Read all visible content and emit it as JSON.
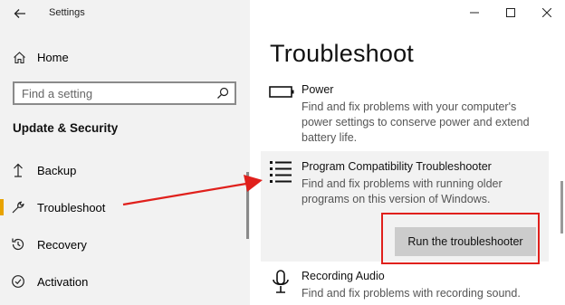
{
  "app": {
    "title": "Settings"
  },
  "sidebar": {
    "home_label": "Home",
    "search_placeholder": "Find a setting",
    "section_title": "Update & Security",
    "items": [
      {
        "label": "Backup",
        "icon": "backup-arrow-icon"
      },
      {
        "label": "Troubleshoot",
        "icon": "wrench-icon",
        "selected": true
      },
      {
        "label": "Recovery",
        "icon": "recovery-history-icon"
      },
      {
        "label": "Activation",
        "icon": "activation-check-icon"
      }
    ]
  },
  "main": {
    "page_title": "Troubleshoot",
    "troubleshooters": [
      {
        "name": "Power",
        "description": "Find and fix problems with your computer's power settings to conserve power and extend battery life.",
        "icon": "battery-icon"
      },
      {
        "name": "Program Compatibility Troubleshooter",
        "description": "Find and fix problems with running older programs on this version of Windows.",
        "icon": "list-icon",
        "selected": true,
        "action_label": "Run the troubleshooter"
      },
      {
        "name": "Recording Audio",
        "description": "Find and fix problems with recording sound.",
        "icon": "microphone-icon"
      }
    ]
  },
  "colors": {
    "sidebar_bg": "#f2f2f2",
    "accent": "#e8a300",
    "annotation_red": "#e0201c",
    "button_bg": "#cccccc"
  }
}
